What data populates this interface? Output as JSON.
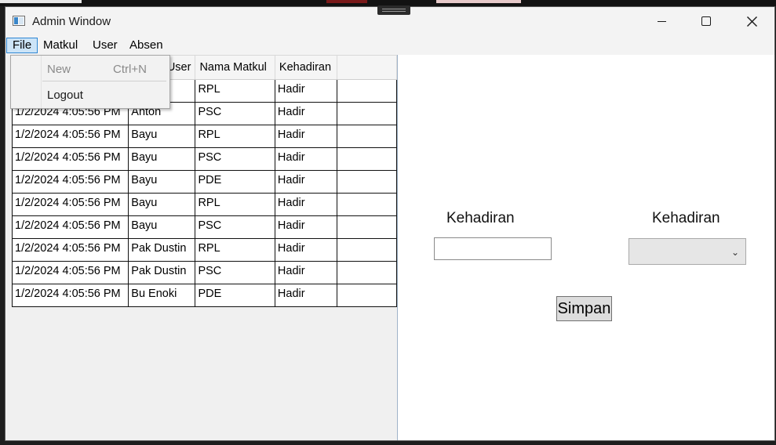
{
  "window": {
    "title": "Admin Window"
  },
  "menu": {
    "file": "File",
    "matkul": "Matkul",
    "user": "User",
    "absen": "Absen"
  },
  "file_menu": {
    "new_label": "New",
    "new_shortcut": "Ctrl+N",
    "logout_label": "Logout"
  },
  "grid": {
    "headers": [
      "User",
      "Nama Matkul",
      "Kehadiran"
    ],
    "rows": [
      {
        "date": "",
        "user": "",
        "matkul": "RPL",
        "status": "Hadir"
      },
      {
        "date": "1/2/2024 4:05:56 PM",
        "user": "Anton",
        "matkul": "PSC",
        "status": "Hadir"
      },
      {
        "date": "1/2/2024 4:05:56 PM",
        "user": "Bayu",
        "matkul": "RPL",
        "status": "Hadir"
      },
      {
        "date": "1/2/2024 4:05:56 PM",
        "user": "Bayu",
        "matkul": "PSC",
        "status": "Hadir"
      },
      {
        "date": "1/2/2024 4:05:56 PM",
        "user": "Bayu",
        "matkul": "PDE",
        "status": "Hadir"
      },
      {
        "date": "1/2/2024 4:05:56 PM",
        "user": "Bayu",
        "matkul": "RPL",
        "status": "Hadir"
      },
      {
        "date": "1/2/2024 4:05:56 PM",
        "user": "Bayu",
        "matkul": "PSC",
        "status": "Hadir"
      },
      {
        "date": "1/2/2024 4:05:56 PM",
        "user": "Pak Dustin",
        "matkul": "RPL",
        "status": "Hadir"
      },
      {
        "date": "1/2/2024 4:05:56 PM",
        "user": "Pak Dustin",
        "matkul": "PSC",
        "status": "Hadir"
      },
      {
        "date": "1/2/2024 4:05:56 PM",
        "user": "Bu Enoki",
        "matkul": "PDE",
        "status": "Hadir"
      }
    ]
  },
  "form": {
    "label_left": "Kehadiran",
    "label_right": "Kehadiran",
    "text_value": "",
    "combo_value": "",
    "save_label": "Simpan"
  },
  "colors": {
    "menu_highlight": "#cce4f7",
    "menu_border": "#2d86d3"
  }
}
